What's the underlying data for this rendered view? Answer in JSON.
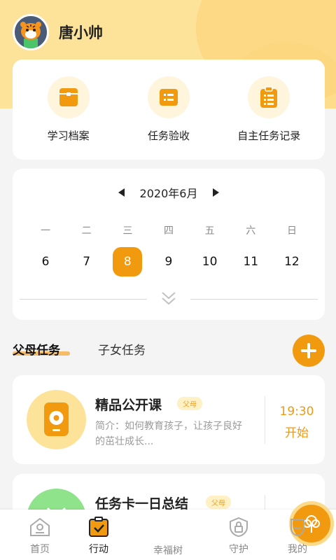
{
  "user": {
    "name": "唐小帅"
  },
  "quick": [
    {
      "label": "学习档案",
      "icon": "folder-icon"
    },
    {
      "label": "任务验收",
      "icon": "checklist-icon"
    },
    {
      "label": "自主任务记录",
      "icon": "clipboard-icon"
    }
  ],
  "calendar": {
    "month": "2020年6月",
    "weekdays": [
      "一",
      "二",
      "三",
      "四",
      "五",
      "六",
      "日"
    ],
    "days": [
      "6",
      "7",
      "8",
      "9",
      "10",
      "11",
      "12"
    ],
    "selected": "8"
  },
  "tabs": {
    "parent": "父母任务",
    "child": "子女任务"
  },
  "tasks": [
    {
      "title": "精品公开课",
      "tag": "父母",
      "desc": "简介：如何教育孩子，让孩子良好的茁壮成长...",
      "time": "19:30",
      "action": "开始"
    },
    {
      "title": "任务卡一日总结",
      "tag": "父母"
    }
  ],
  "tabbar": [
    {
      "label": "首页",
      "icon": "home-icon"
    },
    {
      "label": "行动",
      "icon": "action-icon"
    },
    {
      "label": "幸福树",
      "icon": "tree-icon"
    },
    {
      "label": "守护",
      "icon": "shield-icon"
    },
    {
      "label": "我的",
      "icon": "profile-icon"
    }
  ],
  "colors": {
    "accent": "#f29a0f",
    "header_bg": "#fde29a"
  }
}
